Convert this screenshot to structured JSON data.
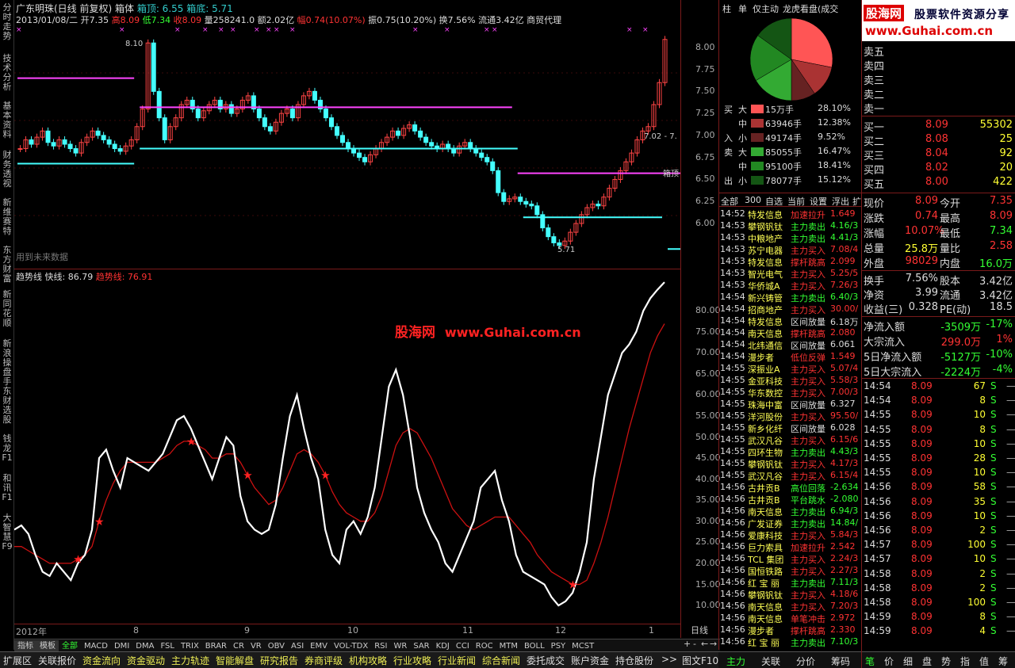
{
  "header": {
    "title_line": "广东明珠(日线 前复权) 箱体",
    "box_top_label": "箱顶: 6.55",
    "box_bottom_label": "箱底: 5.71",
    "date": "2013/01/08/二",
    "open": "开7.35",
    "high": "高8.09",
    "low": "低7.34",
    "close": "收8.09",
    "volume": "量258241.0",
    "amount": "额2.02亿",
    "change": "幅0.74(10.07%)",
    "swing": "振0.75(10.20%)",
    "turnover": "换7.56%",
    "float": "流通3.42亿",
    "industry": "商贸代理"
  },
  "price_axis": [
    "8.00",
    "7.75",
    "7.50",
    "7.25",
    "7.00",
    "6.75",
    "6.50",
    "6.25",
    "6.00"
  ],
  "price_labels": {
    "high": "8.10",
    "low": "5.71",
    "box_range": "7.02 - 7.",
    "box_top": "箱顶"
  },
  "future_data_note": "用到未来数据",
  "indicator": {
    "name": "趋势线",
    "fast_label": "快线: 86.79",
    "trend_label": "趋势线: 76.91"
  },
  "ind_axis": [
    "80.00",
    "75.00",
    "70.00",
    "65.00",
    "60.00",
    "55.00",
    "50.00",
    "45.00",
    "40.00",
    "35.00",
    "30.00",
    "25.00",
    "20.00",
    "15.00",
    "10.00"
  ],
  "watermark": {
    "cn": "股海网",
    "url": "www.Guhai.com.cn"
  },
  "logo": {
    "site": "股海网",
    "slogan": "股票软件资源分享",
    "url": "www.Guhai.com.cn"
  },
  "time_axis": [
    "2012年",
    "8",
    "9",
    "10",
    "11",
    "12",
    "1"
  ],
  "time_axis_label": "日线",
  "left_tabs": [
    "分时走势",
    "技术分析",
    "基本资料",
    "财务透视",
    "新维赛特",
    "东方财富",
    "新同花顺",
    "新浪操盘手",
    "东财选股",
    "钱龙F1",
    "和讯F1",
    "大智慧F9"
  ],
  "indicator_tabs": [
    "指标",
    "模板",
    "全部",
    "MACD",
    "DMI",
    "DMA",
    "FSL",
    "TRIX",
    "BRAR",
    "CR",
    "VR",
    "OBV",
    "ASI",
    "EMV",
    "VOL-TDX",
    "RSI",
    "WR",
    "SAR",
    "KDJ",
    "CCI",
    "ROC",
    "MTM",
    "BOLL",
    "PSY",
    "MCST"
  ],
  "bottom_tabs": [
    "扩展区",
    "关联报价",
    "资金流向",
    "资金驱动",
    "主力轨迹",
    "智能解盘",
    "研究报告",
    "券商评级",
    "机构攻略",
    "行业攻略",
    "行业新闻",
    "综合新闻",
    "委托成交",
    "账户资金",
    "持仓股份",
    ">>",
    "图文F10"
  ],
  "right_tabs_top": [
    "柱",
    "单",
    "仅主动",
    "龙虎看盘(成交"
  ],
  "right_tabs_bottom": [
    "主力",
    "关联",
    "分价",
    "筹码"
  ],
  "quote_tabs_bottom": [
    "笔",
    "价",
    "细",
    "盘",
    "势",
    "指",
    "值",
    "筹"
  ],
  "flow": [
    {
      "side": "买",
      "size": "大",
      "qty": "15万手",
      "pct": "28.10%",
      "color": "#ff5555"
    },
    {
      "side": "",
      "size": "中",
      "qty": "63946手",
      "pct": "12.38%",
      "color": "#aa3333"
    },
    {
      "side": "入",
      "size": "小",
      "qty": "49174手",
      "pct": "9.52%",
      "color": "#662222"
    },
    {
      "side": "卖",
      "size": "大",
      "qty": "85055手",
      "pct": "16.47%",
      "color": "#33aa33"
    },
    {
      "side": "",
      "size": "中",
      "qty": "95100手",
      "pct": "18.41%",
      "color": "#228822"
    },
    {
      "side": "出",
      "size": "小",
      "qty": "78077手",
      "pct": "15.12%",
      "color": "#145514"
    }
  ],
  "pie": [
    {
      "pct": 28.1,
      "color": "#ff5555"
    },
    {
      "pct": 12.38,
      "color": "#aa3333"
    },
    {
      "pct": 9.52,
      "color": "#662222"
    },
    {
      "pct": 16.47,
      "color": "#33aa33"
    },
    {
      "pct": 18.41,
      "color": "#228822"
    },
    {
      "pct": 15.12,
      "color": "#145514"
    }
  ],
  "list_tabs": [
    "全部",
    "300",
    "自选",
    "当前",
    "设置",
    "浮出",
    "扩"
  ],
  "radar": [
    [
      "14:52",
      "特发信息",
      "加速拉升",
      "1.649",
      "red"
    ],
    [
      "14:53",
      "攀钢钒钛",
      "主力卖出",
      "4.16/3",
      "grn"
    ],
    [
      "14:53",
      "中粮地产",
      "主力卖出",
      "4.41/3",
      "grn"
    ],
    [
      "14:53",
      "苏宁电器",
      "主力买入",
      "7.08/4",
      "red"
    ],
    [
      "14:53",
      "特发信息",
      "撑杆跳高",
      "2.099",
      "red"
    ],
    [
      "14:53",
      "智光电气",
      "主力买入",
      "5.25/5",
      "red"
    ],
    [
      "14:53",
      "华侨城A",
      "主力买入",
      "7.26/3",
      "red"
    ],
    [
      "14:54",
      "新兴铸管",
      "主力卖出",
      "6.40/3",
      "grn"
    ],
    [
      "14:54",
      "招商地产",
      "主力买入",
      "30.00/",
      "red"
    ],
    [
      "14:54",
      "特发信息",
      "区间放量",
      "6.18万",
      "wht"
    ],
    [
      "14:54",
      "南天信息",
      "撑杆跳高",
      "2.080",
      "red"
    ],
    [
      "14:54",
      "北纬通信",
      "区间放量",
      "6.061",
      "wht"
    ],
    [
      "14:54",
      "漫步者",
      "低位反弹",
      "1.549",
      "red"
    ],
    [
      "14:55",
      "深振业A",
      "主力买入",
      "5.07/4",
      "red"
    ],
    [
      "14:55",
      "金亚科技",
      "主力买入",
      "5.58/3",
      "red"
    ],
    [
      "14:55",
      "华东数控",
      "主力买入",
      "7.00/3",
      "red"
    ],
    [
      "14:55",
      "珠海中富",
      "区间放量",
      "6.327",
      "wht"
    ],
    [
      "14:55",
      "洋河股份",
      "主力买入",
      "95.50/",
      "red"
    ],
    [
      "14:55",
      "新乡化纤",
      "区间放量",
      "6.028",
      "wht"
    ],
    [
      "14:55",
      "武汉凡谷",
      "主力买入",
      "6.15/6",
      "red"
    ],
    [
      "14:55",
      "四环生物",
      "主力卖出",
      "4.43/3",
      "grn"
    ],
    [
      "14:55",
      "攀钢钒钛",
      "主力买入",
      "4.17/3",
      "red"
    ],
    [
      "14:55",
      "武汉凡谷",
      "主力买入",
      "6.15/4",
      "red"
    ],
    [
      "14:56",
      "古井贡B",
      "高位回落",
      "-2.634",
      "grn"
    ],
    [
      "14:56",
      "古井贡B",
      "平台跳水",
      "-2.080",
      "grn"
    ],
    [
      "14:56",
      "南天信息",
      "主力卖出",
      "6.94/3",
      "grn"
    ],
    [
      "14:56",
      "广发证券",
      "主力卖出",
      "14.84/",
      "grn"
    ],
    [
      "14:56",
      "爱康科技",
      "主力买入",
      "5.84/3",
      "red"
    ],
    [
      "14:56",
      "巨力索具",
      "加速拉升",
      "2.542",
      "red"
    ],
    [
      "14:56",
      "TCL 集团",
      "主力买入",
      "2.24/3",
      "red"
    ],
    [
      "14:56",
      "国恒铁路",
      "主力买入",
      "2.27/3",
      "red"
    ],
    [
      "14:56",
      "红 宝 丽",
      "主力卖出",
      "7.11/3",
      "grn"
    ],
    [
      "14:56",
      "攀钢钒钛",
      "主力买入",
      "4.18/6",
      "red"
    ],
    [
      "14:56",
      "南天信息",
      "主力买入",
      "7.20/3",
      "red"
    ],
    [
      "14:56",
      "南天信息",
      "单笔冲击",
      "2.972",
      "red"
    ],
    [
      "14:56",
      "漫步者",
      "撑杆跳高",
      "2.330",
      "red"
    ],
    [
      "14:56",
      "红 宝 丽",
      "主力卖出",
      "7.10/3",
      "grn"
    ]
  ],
  "orderbook_sell": [
    "卖五",
    "卖四",
    "卖三",
    "卖二",
    "卖一"
  ],
  "orderbook_buy": [
    [
      "买一",
      "8.09",
      "55302"
    ],
    [
      "买二",
      "8.08",
      "25"
    ],
    [
      "买三",
      "8.04",
      "92"
    ],
    [
      "买四",
      "8.02",
      "20"
    ],
    [
      "买五",
      "8.00",
      "422"
    ]
  ],
  "stats": [
    [
      "现价",
      "8.09",
      "今开",
      "7.35",
      "red",
      "red"
    ],
    [
      "涨跌",
      "0.74",
      "最高",
      "8.09",
      "red",
      "red"
    ],
    [
      "涨幅",
      "10.07%",
      "最低",
      "7.34",
      "red",
      "grn"
    ],
    [
      "总量",
      "25.8万",
      "量比",
      "2.58",
      "yel",
      "red"
    ],
    [
      "外盘",
      "98029",
      "内盘",
      "16.0万",
      "red",
      "grn"
    ]
  ],
  "stats2": [
    [
      "换手",
      "7.56%",
      "股本",
      "3.42亿"
    ],
    [
      "净资",
      "3.99",
      "流通",
      "3.42亿"
    ],
    [
      "收益(三)",
      "0.328",
      "PE(动)",
      "18.5"
    ]
  ],
  "netflow": [
    [
      "净流入额",
      "-3509万",
      "-17%",
      "grn"
    ],
    [
      "大宗流入",
      "299.0万",
      "1%",
      "red"
    ],
    [
      "5日净流入额",
      "-5127万",
      "-10%",
      "grn"
    ],
    [
      "5日大宗流入",
      "-2224万",
      "-4%",
      "grn"
    ]
  ],
  "ticks": [
    [
      "14:54",
      "8.09",
      "67",
      "S"
    ],
    [
      "14:54",
      "8.09",
      "8",
      "S"
    ],
    [
      "14:55",
      "8.09",
      "10",
      "S"
    ],
    [
      "14:55",
      "8.09",
      "8",
      "S"
    ],
    [
      "14:55",
      "8.09",
      "10",
      "S"
    ],
    [
      "14:55",
      "8.09",
      "28",
      "S"
    ],
    [
      "14:55",
      "8.09",
      "10",
      "S"
    ],
    [
      "14:56",
      "8.09",
      "58",
      "S"
    ],
    [
      "14:56",
      "8.09",
      "35",
      "S"
    ],
    [
      "14:56",
      "8.09",
      "10",
      "S"
    ],
    [
      "14:56",
      "8.09",
      "2",
      "S"
    ],
    [
      "14:57",
      "8.09",
      "100",
      "S"
    ],
    [
      "14:57",
      "8.09",
      "10",
      "S"
    ],
    [
      "14:58",
      "8.09",
      "2",
      "S"
    ],
    [
      "14:58",
      "8.09",
      "2",
      "S"
    ],
    [
      "14:58",
      "8.09",
      "100",
      "S"
    ],
    [
      "14:59",
      "8.09",
      "8",
      "S"
    ],
    [
      "14:59",
      "8.09",
      "4",
      "S"
    ]
  ],
  "tick_placeholder": "—",
  "zoom_controls": [
    "+",
    "-",
    "←",
    "→"
  ],
  "chart_data": {
    "type": "line",
    "price_panel": {
      "ylim": [
        5.55,
        8.25
      ],
      "candles": [
        6.85,
        6.95,
        6.9,
        6.98,
        7.05,
        6.92,
        6.88,
        6.95,
        6.9,
        6.85,
        6.8,
        6.92,
        6.98,
        7.05,
        7.0,
        6.95,
        6.9,
        6.85,
        6.82,
        6.88,
        6.95,
        7.1,
        7.3,
        8.05,
        7.5,
        7.2,
        6.95,
        7.1,
        7.2,
        7.35,
        7.4,
        7.3,
        7.2,
        7.28,
        7.35,
        7.4,
        7.3,
        7.35,
        7.25,
        7.3,
        7.4,
        7.45,
        7.3,
        7.2,
        7.1,
        7.05,
        7.15,
        7.25,
        7.3,
        7.2,
        7.35,
        7.45,
        7.5,
        7.4,
        7.3,
        7.2,
        7.1,
        7.0,
        6.92,
        6.85,
        6.8,
        6.75,
        6.7,
        6.78,
        6.85,
        6.92,
        6.98,
        7.05,
        7.0,
        7.08,
        7.12,
        7.05,
        6.98,
        6.92,
        6.88,
        6.85,
        6.9,
        6.85,
        6.8,
        6.88,
        6.92,
        6.85,
        6.8,
        6.75,
        6.7,
        6.6,
        6.35,
        6.25,
        6.28,
        6.3,
        6.25,
        6.22,
        6.2,
        6.1,
        5.95,
        5.85,
        5.78,
        5.75,
        5.8,
        5.9,
        6.0,
        6.1,
        6.18,
        6.22,
        6.2,
        6.3,
        6.4,
        6.5,
        6.6,
        6.7,
        6.8,
        6.95,
        7.05,
        7.1,
        7.35,
        7.6,
        8.09
      ],
      "box_top_lines": [
        [
          0,
          21,
          7.65
        ],
        [
          22,
          89,
          7.32
        ],
        [
          90,
          136,
          6.57
        ]
      ],
      "box_bottom_lines": [
        [
          0,
          21,
          6.68
        ],
        [
          22,
          90,
          6.85
        ],
        [
          91,
          116,
          6.07
        ],
        [
          117,
          136,
          5.71
        ]
      ]
    },
    "indicator_panel": {
      "ylim": [
        7,
        87
      ],
      "fast": [
        28,
        29,
        27,
        22,
        18,
        17,
        20,
        18,
        16,
        20,
        22,
        28,
        45,
        47,
        42,
        38,
        45,
        44,
        43,
        42,
        44,
        46,
        50,
        54,
        55,
        52,
        48,
        44,
        40,
        45,
        50,
        48,
        36,
        30,
        28,
        27,
        28,
        34,
        45,
        55,
        60,
        52,
        45,
        40,
        28,
        22,
        20,
        28,
        30,
        27,
        31,
        38,
        50,
        62,
        66,
        60,
        50,
        38,
        32,
        28,
        25,
        20,
        18,
        22,
        26,
        30,
        38,
        40,
        42,
        35,
        30,
        22,
        18,
        17,
        16,
        15,
        12,
        10,
        11,
        13,
        18,
        25,
        40,
        50,
        60,
        65,
        70,
        72,
        75,
        80,
        83,
        85,
        86.79
      ],
      "trend": [
        24,
        24,
        23,
        22,
        21,
        20,
        20,
        20,
        20,
        21,
        22,
        24,
        30,
        35,
        39,
        42,
        44,
        44,
        44,
        44,
        44,
        45,
        46,
        48,
        49,
        49,
        48,
        47,
        45,
        45,
        46,
        46,
        44,
        41,
        38,
        36,
        34,
        35,
        38,
        42,
        46,
        47,
        46,
        44,
        41,
        37,
        34,
        32,
        31,
        30,
        30,
        32,
        36,
        42,
        48,
        51,
        52,
        51,
        48,
        45,
        41,
        37,
        33,
        31,
        29,
        28,
        29,
        30,
        31,
        31,
        31,
        29,
        27,
        25,
        22,
        20,
        18,
        17,
        16,
        15,
        15,
        16,
        20,
        25,
        31,
        38,
        45,
        52,
        58,
        64,
        70,
        74,
        76.91
      ]
    }
  }
}
